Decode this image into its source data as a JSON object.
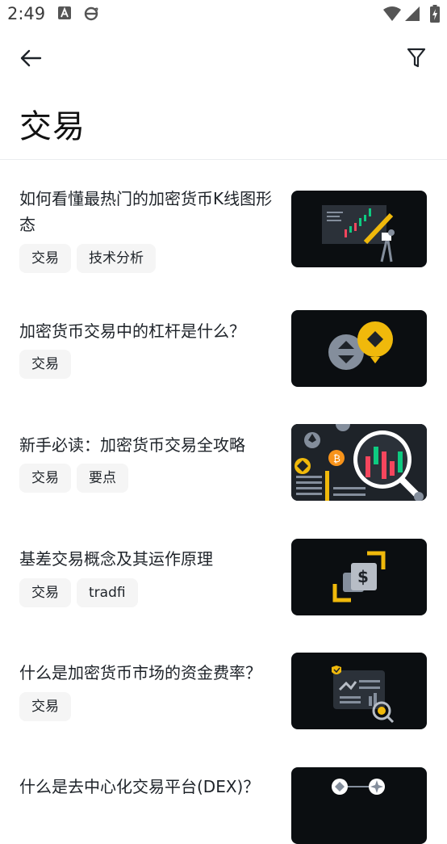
{
  "status_bar": {
    "time": "2:49"
  },
  "page": {
    "title": "交易"
  },
  "articles": [
    {
      "title": "如何看懂最热门的加密货币K线图形态",
      "tags": [
        "交易",
        "技术分析"
      ]
    },
    {
      "title": "加密货币交易中的杠杆是什么？",
      "tags": [
        "交易"
      ]
    },
    {
      "title": "新手必读：加密货币交易全攻略",
      "tags": [
        "交易",
        "要点"
      ]
    },
    {
      "title": "基差交易概念及其运作原理",
      "tags": [
        "交易",
        "tradfi"
      ]
    },
    {
      "title": "什么是加密货币市场的资金费率？",
      "tags": [
        "交易"
      ]
    },
    {
      "title": "什么是去中心化交易平台(DEX)？",
      "tags": []
    }
  ]
}
